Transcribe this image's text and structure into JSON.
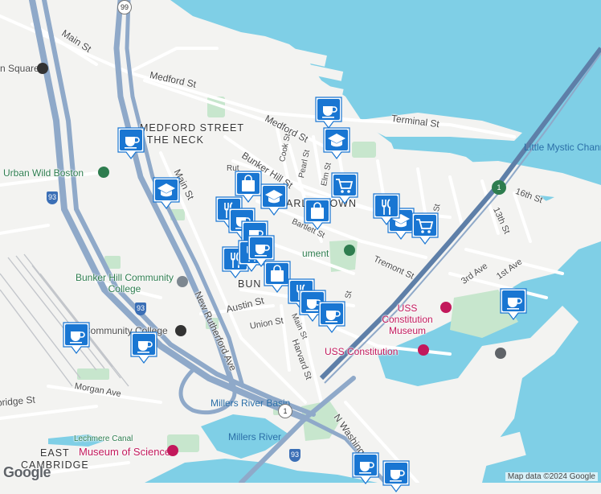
{
  "map": {
    "attribution": "Map data ©2024 Google",
    "provider_logo": "Google",
    "labels": {
      "areas": [
        {
          "id": "medford-neck",
          "text_lines": [
            "MEDFORD STREET",
            "/ THE NECK"
          ]
        },
        {
          "id": "charlestown",
          "text_lines": [
            "CHARLESTOWN"
          ]
        },
        {
          "id": "bunker",
          "text_lines": [
            "BUN"
          ]
        },
        {
          "id": "east-cambridge",
          "text_lines": [
            "EAST",
            "CAMBRIDGE"
          ]
        }
      ],
      "streets": [
        "Main St",
        "Medford St",
        "Medford St",
        "Terminal St",
        "Bunker Hill St",
        "Cook St",
        "Pearl St",
        "Elm St",
        "Rut",
        "Main St",
        "Bartlett St",
        "Tremont St",
        "16th St",
        "13th St",
        "3rd Ave",
        "1st Ave",
        "Austin St",
        "Union St",
        "New Rutherford Ave",
        "Main St",
        "Harvard St",
        "Morgan Ave",
        "Cambridge St",
        "N Washington St",
        "St",
        "St"
      ],
      "water": [
        "Little Mystic Channel",
        "Millers River Basin",
        "Millers River",
        "Lechmere Canal"
      ],
      "places": [
        {
          "id": "square",
          "text": "n Square"
        },
        {
          "id": "urban-wild",
          "text": "Urban Wild Boston"
        },
        {
          "id": "bhcc",
          "text": "Bunker Hill Community College"
        },
        {
          "id": "cc-station",
          "text": "Community College"
        },
        {
          "id": "monument",
          "text": "ument"
        },
        {
          "id": "uss-museum",
          "text": "USS Constitution Museum"
        },
        {
          "id": "uss",
          "text": "USS Constitution"
        },
        {
          "id": "museum-science",
          "text": "Museum of Science"
        }
      ],
      "highways": [
        "99",
        "93",
        "93",
        "93",
        "1",
        "1"
      ]
    },
    "markers": [
      {
        "type": "cafe",
        "icon": "coffee-cup-icon"
      },
      {
        "type": "school",
        "icon": "graduation-cap-icon"
      },
      {
        "type": "cafe",
        "icon": "coffee-cup-icon"
      },
      {
        "type": "school",
        "icon": "graduation-cap-icon"
      },
      {
        "type": "shopping",
        "icon": "shopping-bag-icon"
      },
      {
        "type": "school",
        "icon": "graduation-cap-icon"
      },
      {
        "type": "grocery",
        "icon": "shopping-cart-icon"
      },
      {
        "type": "restaurant",
        "icon": "fork-knife-icon"
      },
      {
        "type": "school",
        "icon": "graduation-cap-icon"
      },
      {
        "type": "grocery",
        "icon": "shopping-cart-icon"
      },
      {
        "type": "restaurant",
        "icon": "fork-knife-icon"
      },
      {
        "type": "shopping",
        "icon": "shopping-bag-icon"
      },
      {
        "type": "cafe",
        "icon": "coffee-cup-icon"
      },
      {
        "type": "cafe",
        "icon": "coffee-cup-icon"
      },
      {
        "type": "restaurant",
        "icon": "fork-knife-icon"
      },
      {
        "type": "restaurant",
        "icon": "fork-knife-icon"
      },
      {
        "type": "cafe",
        "icon": "coffee-cup-icon"
      },
      {
        "type": "shopping",
        "icon": "shopping-bag-icon"
      },
      {
        "type": "restaurant",
        "icon": "fork-knife-icon"
      },
      {
        "type": "cafe",
        "icon": "coffee-cup-icon"
      },
      {
        "type": "cafe",
        "icon": "coffee-cup-icon"
      },
      {
        "type": "cafe",
        "icon": "coffee-cup-icon"
      },
      {
        "type": "cafe",
        "icon": "coffee-cup-icon"
      },
      {
        "type": "cafe",
        "icon": "coffee-cup-icon"
      },
      {
        "type": "cafe",
        "icon": "coffee-cup-icon"
      }
    ],
    "colors": {
      "water": "#7fcfe6",
      "land": "#f3f3f1",
      "park": "#c7e6cd",
      "highway": "#8fa9c9",
      "rail": "#b0b4ba",
      "marker": "#1976d2",
      "poi": "#c2185b"
    }
  }
}
